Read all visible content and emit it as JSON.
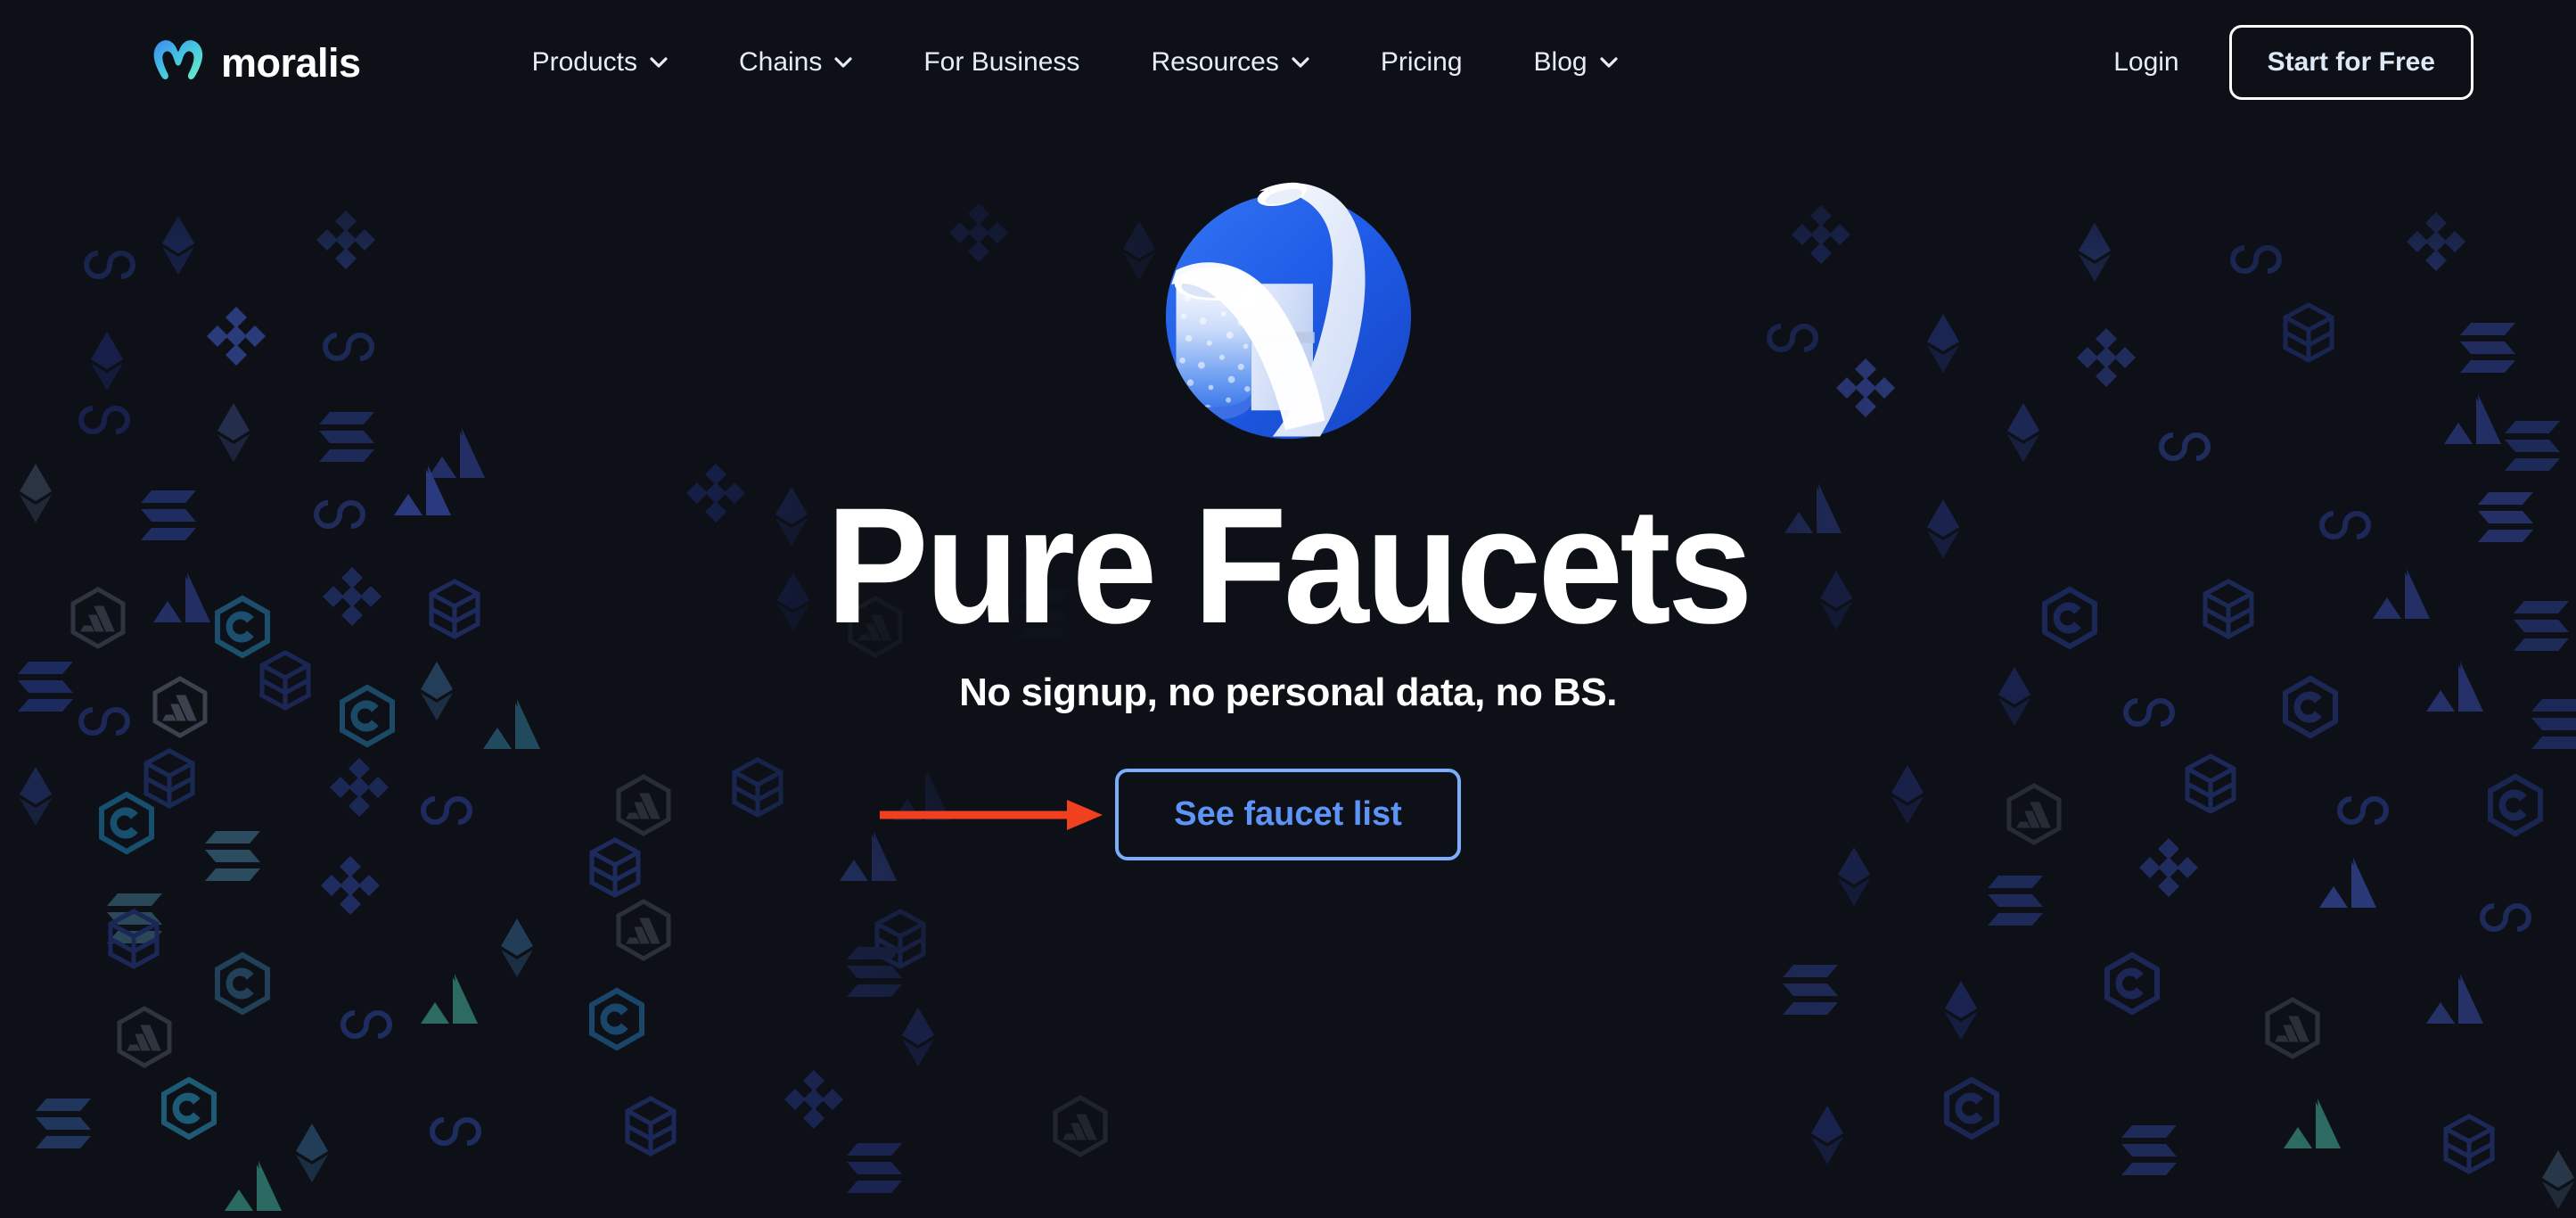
{
  "brand": {
    "name": "moralis",
    "logo_icon": "moralis-m-logo",
    "gradient_from": "#3d8cf2",
    "gradient_to": "#6ff0c4"
  },
  "nav": {
    "items": [
      {
        "label": "Products",
        "has_dropdown": true,
        "icon": "chevron-down-icon"
      },
      {
        "label": "Chains",
        "has_dropdown": true,
        "icon": "chevron-down-icon"
      },
      {
        "label": "For Business",
        "has_dropdown": false
      },
      {
        "label": "Resources",
        "has_dropdown": true,
        "icon": "chevron-down-icon"
      },
      {
        "label": "Pricing",
        "has_dropdown": false
      },
      {
        "label": "Blog",
        "has_dropdown": true,
        "icon": "chevron-down-icon"
      }
    ],
    "login_label": "Login",
    "cta_label": "Start for Free"
  },
  "hero": {
    "logo_icon": "faucet-beaker-icon",
    "title": "Pure Faucets",
    "subtitle": "No signup, no personal data, no BS.",
    "cta_label": "See faucet list",
    "cta_border_color": "#7aaefa",
    "cta_text_color": "#5e93f7"
  },
  "annotation": {
    "type": "arrow",
    "direction": "right",
    "color": "#f0401f",
    "points_to": "See faucet list"
  },
  "background": {
    "color": "#0d1117",
    "pattern": "crypto-token-logos",
    "tokens": [
      "ethereum",
      "binance",
      "polygon",
      "avalanche",
      "solana",
      "fantom",
      "arbitrum",
      "cronos"
    ]
  },
  "theme": {
    "page_bg": "#0d1117",
    "text_primary": "#ffffff",
    "text_nav": "#e8edf5",
    "accent_blue": "#2563eb"
  }
}
